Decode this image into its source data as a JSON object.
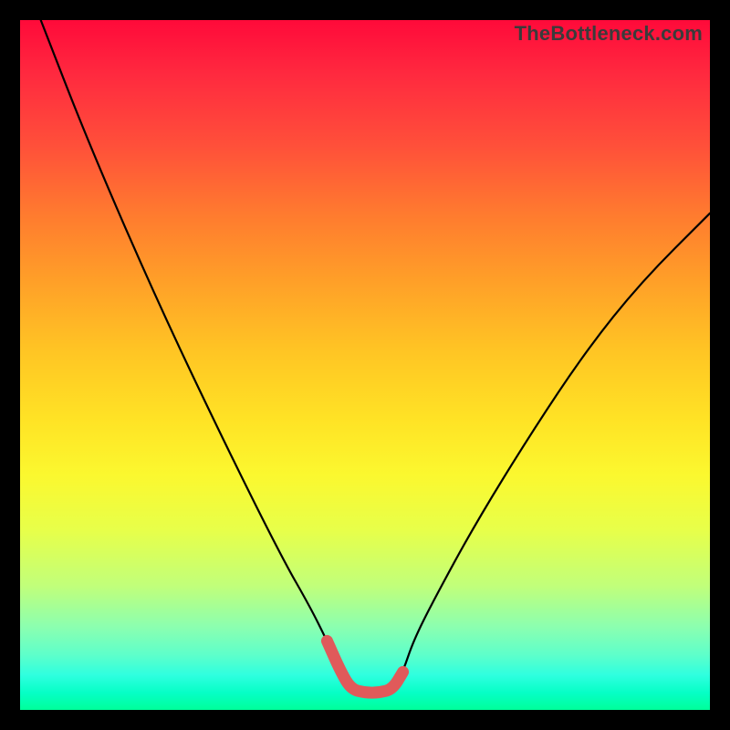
{
  "watermark": "TheBottleneck.com",
  "chart_data": {
    "type": "line",
    "title": "",
    "xlabel": "",
    "ylabel": "",
    "xlim": [
      0,
      100
    ],
    "ylim": [
      0,
      100
    ],
    "series": [
      {
        "name": "black-curve",
        "x": [
          3,
          10,
          20,
          30,
          38,
          42,
          44.5,
          46.5,
          48,
          50,
          52,
          54,
          55.5,
          57,
          60,
          66,
          74,
          82,
          90,
          100
        ],
        "y": [
          100,
          82,
          59,
          38,
          22,
          15,
          10,
          5.5,
          3,
          2.5,
          2.5,
          3,
          5.5,
          10,
          16,
          27,
          40,
          52,
          62,
          72
        ]
      },
      {
        "name": "red-bottom-segment",
        "x": [
          44.5,
          46.5,
          48,
          50,
          52,
          54,
          55.5
        ],
        "y": [
          10,
          5.5,
          3,
          2.5,
          2.5,
          3,
          5.5
        ]
      }
    ],
    "colors": {
      "black-curve": "#000000",
      "red-bottom-segment": "#e05a5a"
    },
    "gradient_stops": [
      {
        "pos": 0,
        "color": "#ff0a3a"
      },
      {
        "pos": 0.28,
        "color": "#ff7a2f"
      },
      {
        "pos": 0.58,
        "color": "#ffe325"
      },
      {
        "pos": 0.82,
        "color": "#c1ff7a"
      },
      {
        "pos": 1.0,
        "color": "#00ff9a"
      }
    ]
  }
}
